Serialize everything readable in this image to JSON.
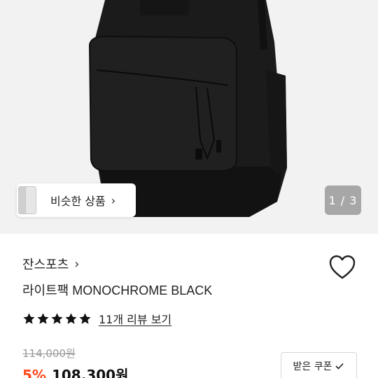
{
  "gallery": {
    "similar_label": "비슷한 상품",
    "similar_chevron": "›",
    "pager_text": "1 / 3"
  },
  "product": {
    "brand": "잔스포츠",
    "brand_chevron": "›",
    "name": "라이트팩 MONOCHROME BLACK",
    "rating_stars": 5,
    "review_link": "11개 리뷰 보기",
    "original_price": "114,000원",
    "discount": "5%",
    "sale_price": "108,300원"
  },
  "coupon": {
    "label": "받은 쿠폰",
    "icon": "check-icon"
  },
  "colors": {
    "discount": "#ff4a1c",
    "hero_bg": "#f2f2f2",
    "pager_bg": "#a7a7a7"
  }
}
